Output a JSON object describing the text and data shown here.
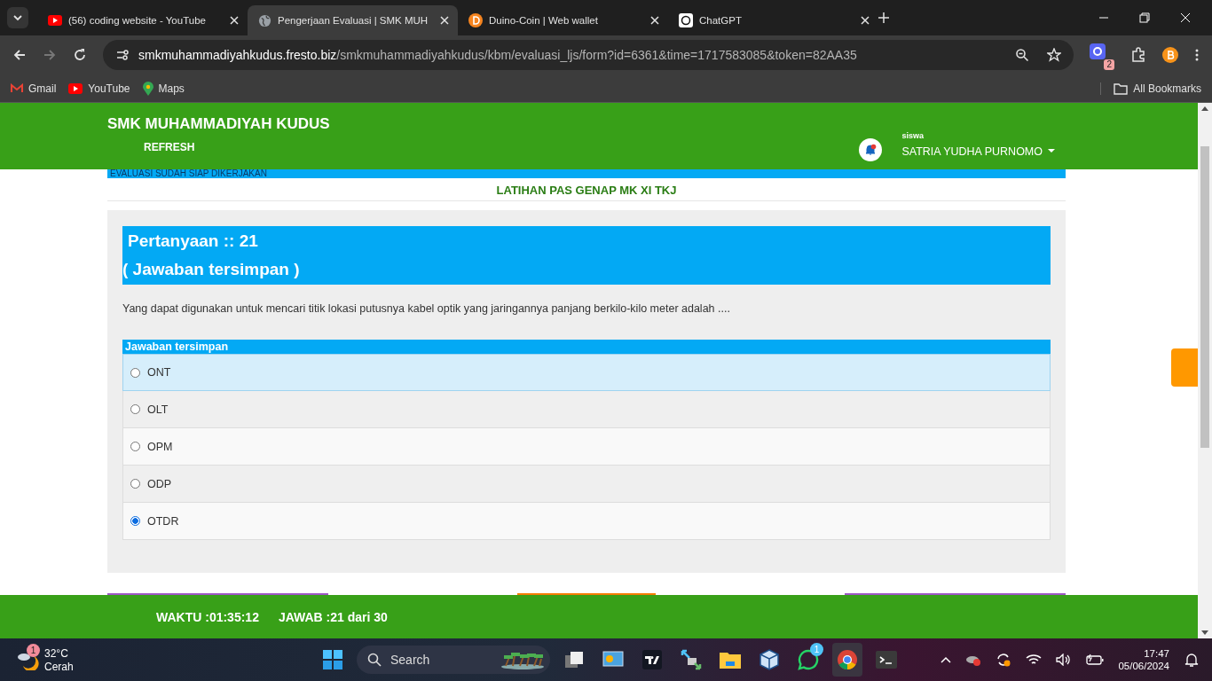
{
  "browser": {
    "tabs": [
      {
        "title": "(56) coding website - YouTube",
        "kind": "youtube",
        "selected": false
      },
      {
        "title": "Pengerjaan Evaluasi | SMK MUH",
        "kind": "globe",
        "selected": true
      },
      {
        "title": "Duino-Coin | Web wallet",
        "kind": "duino",
        "selected": false
      },
      {
        "title": "ChatGPT",
        "kind": "chatgpt",
        "selected": false
      }
    ],
    "url_host": "smkmuhammadiyahkudus.fresto.biz",
    "url_path": "/smkmuhammadiyahkudus/kbm/evaluasi_ljs/form?id=6361&time=1717583085&token=82AA35",
    "extension_badge": "2",
    "bookmarks": [
      {
        "label": "Gmail",
        "kind": "gmail"
      },
      {
        "label": "YouTube",
        "kind": "youtube"
      },
      {
        "label": "Maps",
        "kind": "maps"
      }
    ],
    "all_bookmarks": "All Bookmarks"
  },
  "header": {
    "school": "SMK MUHAMMADIYAH KUDUS",
    "refresh": "REFRESH",
    "role": "siswa",
    "user": "SATRIA YUDHA PURNOMO"
  },
  "notice": "EVALUASI SUDAH SIAP  DIKERJAKAN",
  "exam_title": "LATIHAN PAS GENAP MK XI TKJ",
  "question": {
    "number": "Pertanyaan :: 21",
    "status": "( Jawaban tersimpan )",
    "text": "Yang dapat digunakan untuk mencari titik lokasi putusnya  kabel optik yang jaringannya panjang berkilo-kilo meter adalah ....",
    "answer_label": "Jawaban tersimpan",
    "options": [
      {
        "label": "ONT",
        "selected": false,
        "highlighted": true
      },
      {
        "label": "OLT",
        "selected": false,
        "highlighted": false
      },
      {
        "label": "OPM",
        "selected": false,
        "highlighted": false
      },
      {
        "label": "ODP",
        "selected": false,
        "highlighted": false
      },
      {
        "label": "OTDR",
        "selected": true,
        "highlighted": false
      }
    ]
  },
  "footer": {
    "time": "WAKTU :01:35:12",
    "answered": "JAWAB :21 dari 30"
  },
  "taskbar": {
    "temperature": "32°C",
    "condition": "Cerah",
    "weather_badge": "1",
    "search": "Search",
    "apps": [
      {
        "kind": "windows"
      },
      {
        "kind": "taskview"
      },
      {
        "kind": "monitor"
      },
      {
        "kind": "tradingview"
      },
      {
        "kind": "vpn"
      },
      {
        "kind": "folder"
      },
      {
        "kind": "virtualbox"
      },
      {
        "kind": "whatsapp",
        "badge": "1"
      },
      {
        "kind": "chrome",
        "active": true
      },
      {
        "kind": "terminal"
      }
    ],
    "time": "17:47",
    "date": "05/06/2024"
  }
}
